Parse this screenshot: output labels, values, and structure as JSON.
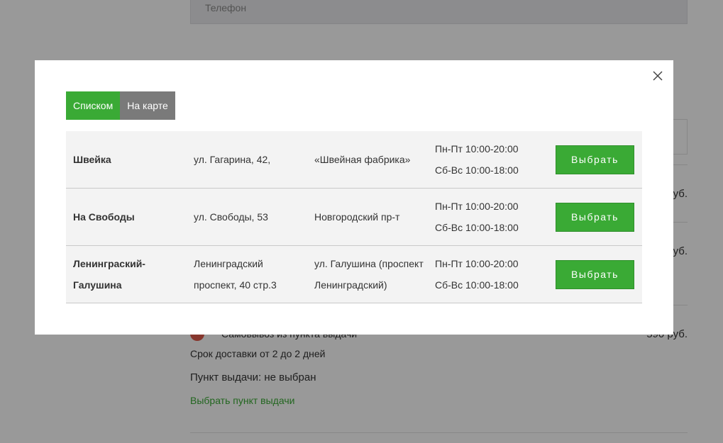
{
  "background": {
    "phone_placeholder": "Телефон",
    "prices": [
      "руб.",
      "руб.",
      "590 руб."
    ],
    "pickup_option_label": "Самовывоз из пункта выдачи",
    "delivery_term": "Срок доставки от 2 до 2 дней",
    "pickup_point_status": "Пункт выдачи: не выбран",
    "choose_pickup_link": "Выбрать пункт выдачи"
  },
  "modal": {
    "tabs": [
      {
        "label": "Списком",
        "active": true
      },
      {
        "label": "На карте",
        "active": false
      }
    ],
    "select_label": "Выбрать",
    "points": [
      {
        "name": "Швейка",
        "address": "ул. Гагарина, 42,",
        "landmark": "«Швейная фабрика»",
        "hours_weekdays": "Пн-Пт 10:00-20:00",
        "hours_weekend": "Сб-Вс 10:00-18:00"
      },
      {
        "name": "На Свободы",
        "address": "ул. Свободы, 53",
        "landmark": "Новгородский пр-т",
        "hours_weekdays": "Пн-Пт 10:00-20:00",
        "hours_weekend": "Сб-Вс 10:00-18:00"
      },
      {
        "name": "Ленинграский-Галушина",
        "address": "Ленинградский проспект, 40 стр.3",
        "landmark": "ул. Галушина (проспект Ленинградский)",
        "hours_weekdays": "Пн-Пт 10:00-20:00",
        "hours_weekend": "Сб-Вс 10:00-18:00"
      }
    ]
  },
  "colors": {
    "accent_green": "#3aaa35",
    "tab_inactive": "#7a7a7a",
    "radio_red": "#e05a4c"
  }
}
